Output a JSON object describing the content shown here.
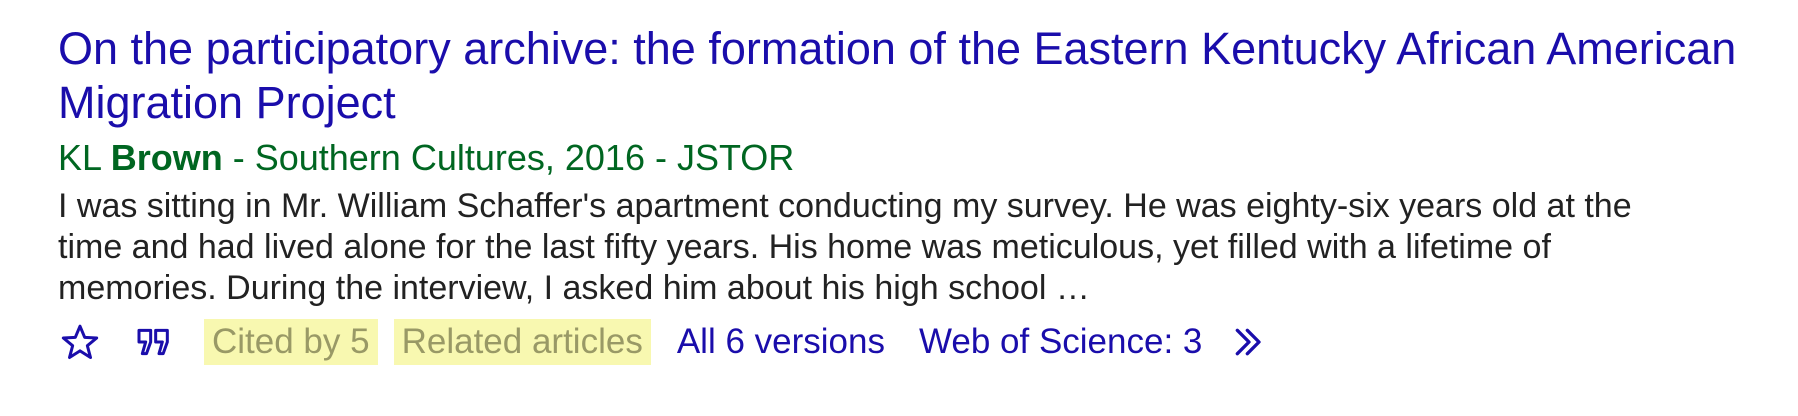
{
  "result": {
    "title": "On the participatory archive: the formation of the Eastern Kentucky African American Migration Project",
    "author_initials": "KL",
    "author_surname": "Brown",
    "source": " - Southern Cultures, 2016 - JSTOR",
    "snippet": "I was sitting in Mr. William Schaffer's apartment conducting my survey. He was eighty-six years old at the time and had lived alone for the last fifty years. His home was meticulous, yet filled with a lifetime of memories. During the interview, I asked him about his high school …"
  },
  "actions": {
    "save_icon": "star-icon",
    "cite_icon": "quote-icon",
    "cited_by": "Cited by 5",
    "related": "Related articles",
    "versions": "All 6 versions",
    "web_of_science": "Web of Science: 3",
    "more_icon": "double-chevron-icon"
  },
  "colors": {
    "title": "#1a0dab",
    "meta": "#006621",
    "snippet": "#222222",
    "highlight_bg": "#f8f8b0",
    "highlight_text": "#999966"
  }
}
